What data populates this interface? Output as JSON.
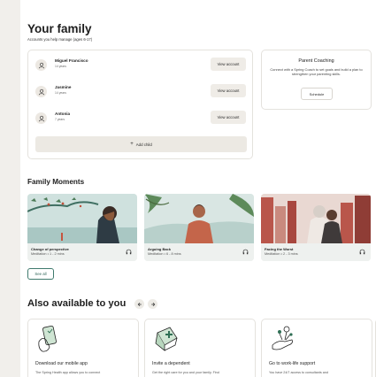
{
  "family": {
    "title": "Your family",
    "subtitle": "Accounts you help manage (ages 6-17)",
    "members": [
      {
        "name": "Miguel Francisco",
        "age": "14 years",
        "button": "View account"
      },
      {
        "name": "Jasmine",
        "age": "14 years",
        "button": "View account"
      },
      {
        "name": "Antonia",
        "age": "7 years",
        "button": "View account"
      }
    ],
    "add_child_label": "Add child"
  },
  "coaching": {
    "title": "Parent Coaching",
    "description": "Connect with a Spring Coach to set goals and build a plan to strengthen your parenting skills.",
    "button": "Schedule"
  },
  "moments": {
    "title": "Family Moments",
    "items": [
      {
        "title": "Change of perspective",
        "meta": "Meditation • 1 - 2 mins"
      },
      {
        "title": "Arguing Back",
        "meta": "Meditation • 6 - 8 mins"
      },
      {
        "title": "Facing the Worst",
        "meta": "Meditation • 2 - 3 mins"
      }
    ],
    "see_all": "See all"
  },
  "available": {
    "title": "Also available to you",
    "items": [
      {
        "title": "Download our mobile app",
        "description": "The Spring Health app allows you to connect"
      },
      {
        "title": "Invite a dependent",
        "description": "Get the right care for you and your family. Find"
      },
      {
        "title": "Go to work-life support",
        "description": "You have 24/7 access to consultants and"
      }
    ]
  },
  "colors": {
    "accent": "#3f7a6d",
    "background": "#f1efeb",
    "button_bg": "#efece7"
  }
}
